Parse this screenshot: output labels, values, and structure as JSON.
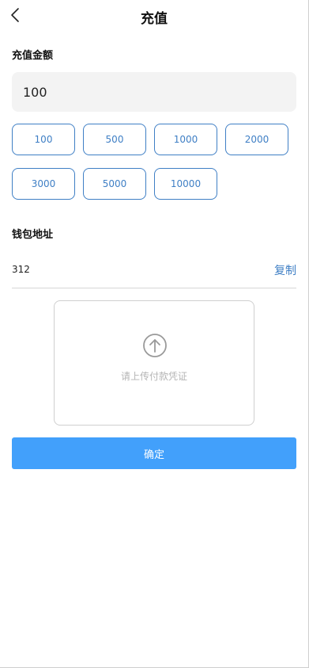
{
  "header": {
    "back_icon": "chevron-left-icon",
    "title": "充值"
  },
  "amount_section": {
    "label": "充值金额",
    "input_value": "100",
    "options": [
      "100",
      "500",
      "1000",
      "2000",
      "3000",
      "5000",
      "10000"
    ]
  },
  "wallet_section": {
    "label": "钱包地址",
    "address": "312",
    "copy_label": "复制"
  },
  "upload": {
    "icon": "upload-arrow-icon",
    "hint": "请上传付款凭证"
  },
  "confirm_label": "确定",
  "colors": {
    "accent": "#3f7fc5",
    "primary_button": "#42a0fb",
    "input_bg": "#f3f3f3"
  }
}
